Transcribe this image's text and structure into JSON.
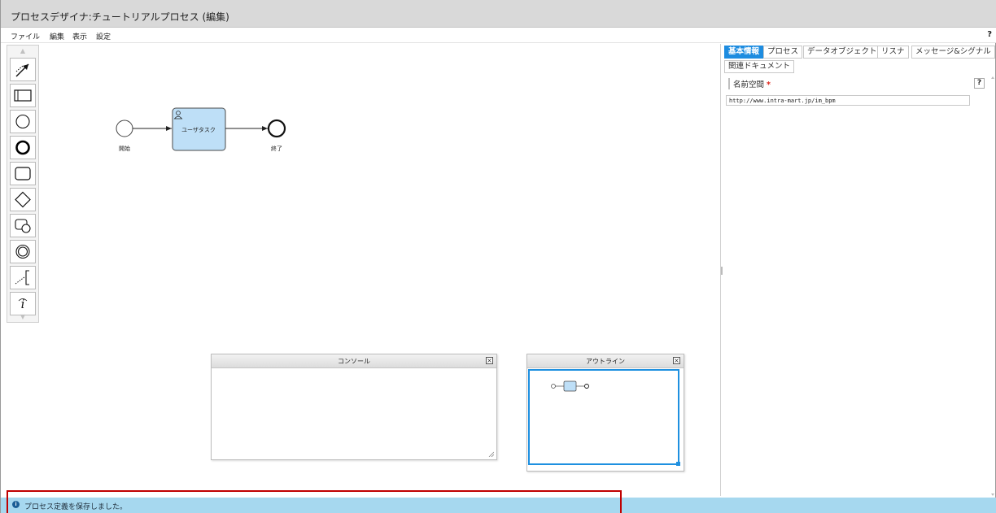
{
  "window": {
    "title": "プロセスデザイナ:チュートリアルプロセス (編集)"
  },
  "menu": {
    "items": [
      "ファイル",
      "編集",
      "表示",
      "設定"
    ],
    "help": "?"
  },
  "palette": {
    "tools": [
      "connector-arrow-icon",
      "swimlane-icon",
      "start-event-icon",
      "end-event-icon",
      "task-icon",
      "gateway-icon",
      "subprocess-icon",
      "intermediate-event-icon",
      "annotation-icon",
      "info-icon"
    ]
  },
  "diagram": {
    "start_label": "開始",
    "task_label": "ユーザタスク",
    "end_label": "終了",
    "task_color": "#bedff7"
  },
  "console": {
    "title": "コンソール",
    "close": "×"
  },
  "outline": {
    "title": "アウトライン",
    "close": "×"
  },
  "properties": {
    "tabs": [
      "基本情報",
      "プロセス",
      "データオブジェクト",
      "リスナ",
      "メッセージ&シグナル",
      "関連ドキュメント"
    ],
    "active_tab": "基本情報",
    "field_label": "名前空間",
    "required_mark": "*",
    "help": "?",
    "field_value": "http://www.intra-mart.jp/im_bpm"
  },
  "status": {
    "icon": "info-icon",
    "message": "プロセス定義を保存しました。",
    "background": "#a6d8ef"
  },
  "colors": {
    "accent": "#1d8ce0",
    "highlight_border": "#c00000",
    "outline_frame": "#1e90e0"
  }
}
